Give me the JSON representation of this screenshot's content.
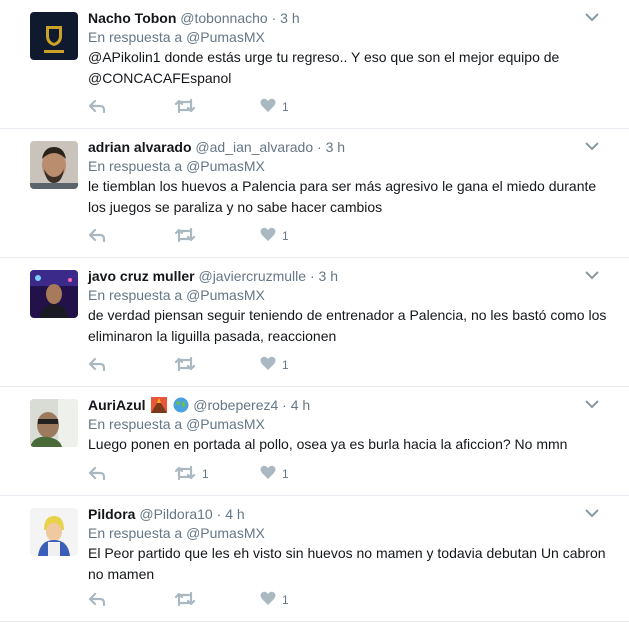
{
  "tweets": [
    {
      "name": "Nacho Tobon",
      "handle": "@tobonnacho",
      "sep": " · ",
      "time": "3 h",
      "reply_prefix": "En respuesta a ",
      "reply_to": "@PumasMX",
      "text": "@APikolin1 donde estás urge tu regreso.. Y eso que son el mejor equipo de @CONCACAFEspanol",
      "retweets": "",
      "likes": "1"
    },
    {
      "name": "adrian alvarado",
      "handle": "@ad_ian_alvarado",
      "sep": " · ",
      "time": "3 h",
      "reply_prefix": "En respuesta a ",
      "reply_to": "@PumasMX",
      "text": "le tiemblan los huevos a Palencia para ser más agresivo le gana el miedo durante los juegos se paraliza y no sabe hacer cambios",
      "retweets": "",
      "likes": "1"
    },
    {
      "name": "javo cruz muller",
      "handle": "@javiercruzmulle",
      "sep": " · ",
      "time": "3 h",
      "reply_prefix": "En respuesta a ",
      "reply_to": "@PumasMX",
      "text": "de verdad piensan seguir teniendo de entrenador a Palencia, no les bastó como los eliminaron la liguilla pasada, reaccionen",
      "retweets": "",
      "likes": "1"
    },
    {
      "name": "AuriAzul",
      "handle": "@robeperez4",
      "sep": " · ",
      "time": "4 h",
      "reply_prefix": "En respuesta a ",
      "reply_to": "@PumasMX",
      "text": "Luego ponen en portada al pollo, osea ya es burla hacia la aficcion? No mmn",
      "retweets": "1",
      "likes": "1"
    },
    {
      "name": "Pildora",
      "handle": "@Pildora10",
      "sep": " · ",
      "time": "4 h",
      "reply_prefix": "En respuesta a ",
      "reply_to": "@PumasMX",
      "text": "El Peor partido que les eh visto  sin huevos no mamen y todavia debutan Un cabron no mamen",
      "retweets": "",
      "likes": "1"
    }
  ],
  "icons": {
    "reply": "reply-icon",
    "retweet": "retweet-icon",
    "like": "heart-icon",
    "more": "chevron-down-icon"
  },
  "colors": {
    "action_grey": "#aab8c2",
    "meta_grey": "#657786",
    "divider": "#e6ecf0"
  }
}
